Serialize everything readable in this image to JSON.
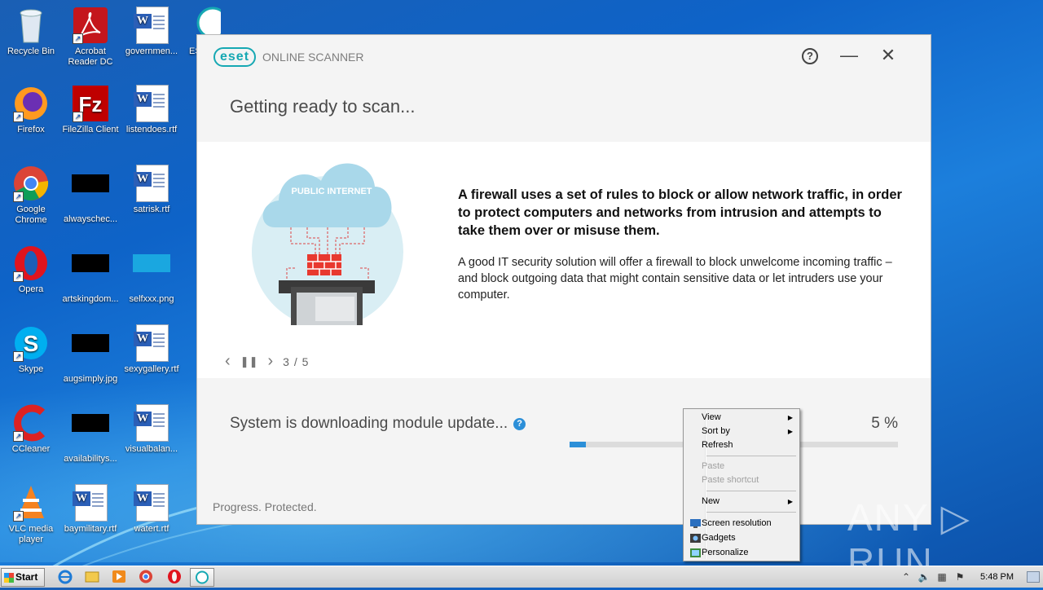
{
  "desktop": {
    "icons": [
      {
        "label": "Recycle Bin",
        "kind": "recycle-bin-icon"
      },
      {
        "label": "Acrobat Reader DC",
        "kind": "acrobat-icon"
      },
      {
        "label": "governmen...",
        "kind": "word-doc-icon"
      },
      {
        "label": "ES",
        "kind": "eset-icon"
      },
      {
        "label": "Firefox",
        "kind": "firefox-icon"
      },
      {
        "label": "FileZilla Client",
        "kind": "filezilla-icon"
      },
      {
        "label": "listendoes.rtf",
        "kind": "word-doc-icon"
      },
      {
        "label": "Google Chrome",
        "kind": "chrome-icon"
      },
      {
        "label": "alwayschec...",
        "kind": "black-image-icon"
      },
      {
        "label": "satrisk.rtf",
        "kind": "word-doc-icon"
      },
      {
        "label": "Opera",
        "kind": "opera-icon"
      },
      {
        "label": "artskingdom...",
        "kind": "black-image-icon"
      },
      {
        "label": "selfxxx.png",
        "kind": "png-image-icon"
      },
      {
        "label": "Skype",
        "kind": "skype-icon"
      },
      {
        "label": "augsimply.jpg",
        "kind": "black-image-icon"
      },
      {
        "label": "sexygallery.rtf",
        "kind": "word-doc-icon"
      },
      {
        "label": "CCleaner",
        "kind": "ccleaner-icon"
      },
      {
        "label": "availabilitys...",
        "kind": "black-image-icon"
      },
      {
        "label": "visualbalan...",
        "kind": "word-doc-icon"
      },
      {
        "label": "VLC media player",
        "kind": "vlc-icon"
      },
      {
        "label": "baymilitary.rtf",
        "kind": "word-doc-icon"
      },
      {
        "label": "watert.rtf",
        "kind": "word-doc-icon"
      }
    ]
  },
  "eset": {
    "logo_badge": "eset",
    "logo_text": "ONLINE SCANNER",
    "help_label": "?",
    "minimize_label": "—",
    "close_label": "✕",
    "heading": "Getting ready to scan...",
    "illustration_label": "PUBLIC INTERNET",
    "message_bold": "A firewall uses a set of rules to block or allow network traffic, in order to protect computers and networks from intrusion and attempts to take them over or misuse them.",
    "message": "A good IT security solution will offer a firewall to block unwelcome incoming traffic – and block outgoing data that might contain sensitive data or let intruders use your computer.",
    "pager": {
      "prev": "‹",
      "pause": "❚❚",
      "next": "›",
      "count": "3 / 5"
    },
    "status_text": "System is downloading module update...",
    "status_help": "?",
    "percent_text": "5 %",
    "progress_fraction": 0.05,
    "tagline": "Progress. Protected.",
    "accent_color": "#16a8b3",
    "progress_color": "#2c8fd8"
  },
  "context_menu": {
    "items": [
      {
        "label": "View",
        "submenu": true,
        "disabled": false
      },
      {
        "label": "Sort by",
        "submenu": true,
        "disabled": false
      },
      {
        "label": "Refresh",
        "submenu": false,
        "disabled": false
      },
      {
        "label": "Paste",
        "submenu": false,
        "disabled": true
      },
      {
        "label": "Paste shortcut",
        "submenu": false,
        "disabled": true
      },
      {
        "label": "New",
        "submenu": true,
        "disabled": false
      },
      {
        "label": "Screen resolution",
        "submenu": false,
        "disabled": false
      },
      {
        "label": "Gadgets",
        "submenu": false,
        "disabled": false
      },
      {
        "label": "Personalize",
        "submenu": false,
        "disabled": false
      }
    ]
  },
  "watermark": "ANY ▷ RUN",
  "taskbar": {
    "start_label": "Start",
    "clock": "5:48 PM",
    "pinned": [
      "internet-explorer-icon",
      "explorer-icon",
      "media-player-icon",
      "chrome-icon",
      "opera-icon",
      "eset-icon"
    ]
  }
}
